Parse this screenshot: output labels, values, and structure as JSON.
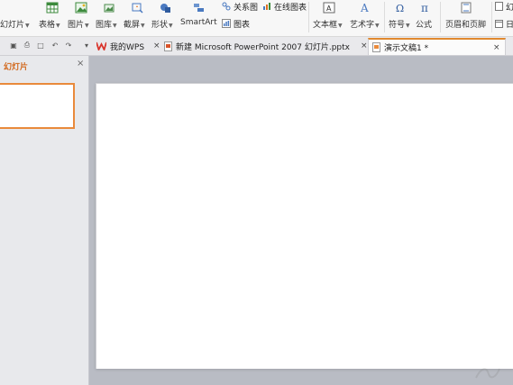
{
  "ribbon": {
    "slides_label": "幻灯片",
    "table_label": "表格",
    "picture_label": "图片",
    "gallery_label": "图库",
    "screenshot_label": "截屏",
    "shape_label": "形状",
    "smartart_label": "SmartArt",
    "relation_label": "关系图",
    "online_chart_label": "在线图表",
    "chart_label": "图表",
    "textbox_label": "文本框",
    "wordart_label": "艺术字",
    "symbol_label": "符号",
    "formula_label": "公式",
    "header_footer_label": "页眉和页脚",
    "clip1_label": "幻",
    "clip2_label": "日"
  },
  "tabs": [
    {
      "label": "我的WPS"
    },
    {
      "label": "新建 Microsoft PowerPoint 2007 幻灯片.pptx"
    },
    {
      "label": "演示文稿1 *"
    }
  ],
  "close_glyph": "×",
  "left_pane": {
    "title": "幻灯片",
    "close_glyph": "×"
  },
  "colors": {
    "accent": "#e98a3b",
    "title_orange": "#d2691e",
    "workspace": "#b9bcc4"
  },
  "icons": [
    "table-icon",
    "picture-icon",
    "gallery-icon",
    "screenshot-icon",
    "shape-icon",
    "relation-icon",
    "online-chart-icon",
    "chart-icon",
    "textbox-icon",
    "wordart-icon",
    "symbol-icon",
    "formula-icon",
    "header-footer-icon",
    "wps-logo-icon",
    "pptx-file-icon",
    "presentation-file-icon"
  ]
}
